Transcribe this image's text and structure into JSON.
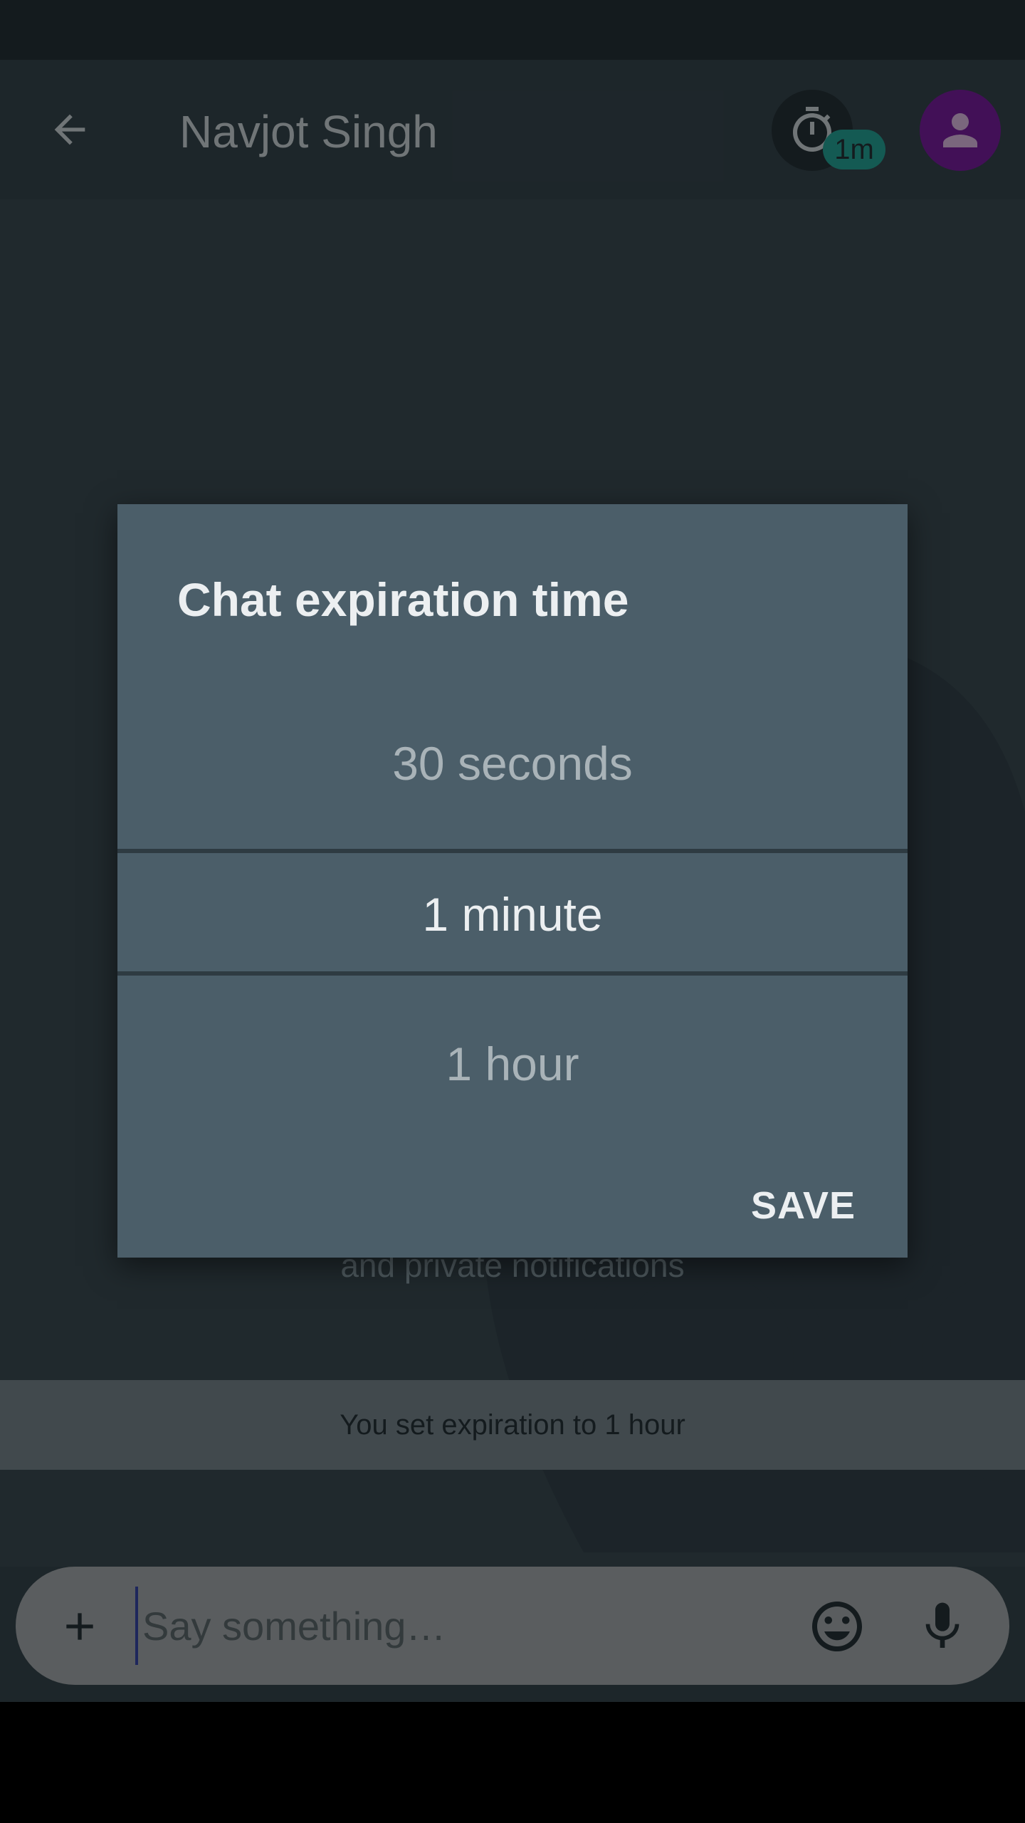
{
  "app_bar": {
    "contact_name": "Navjot Singh",
    "timer_badge": "1m",
    "icons": [
      "back-arrow-icon",
      "timer-icon",
      "person-icon"
    ]
  },
  "chat": {
    "privacy_note": "and private notifications",
    "system_message": "You set expiration to 1 hour"
  },
  "dialog": {
    "title": "Chat expiration time",
    "options": {
      "previous": "30 seconds",
      "selected": "1 minute",
      "next": "1 hour"
    },
    "save_label": "SAVE"
  },
  "composer": {
    "placeholder": "Say something…",
    "icons": [
      "add-icon",
      "emoji-icon",
      "mic-icon"
    ]
  },
  "colors": {
    "avatar": "#7b1fa2",
    "badge": "#26a69a",
    "dialog_bg": "#4b5e69",
    "cursor": "#3949ab"
  }
}
